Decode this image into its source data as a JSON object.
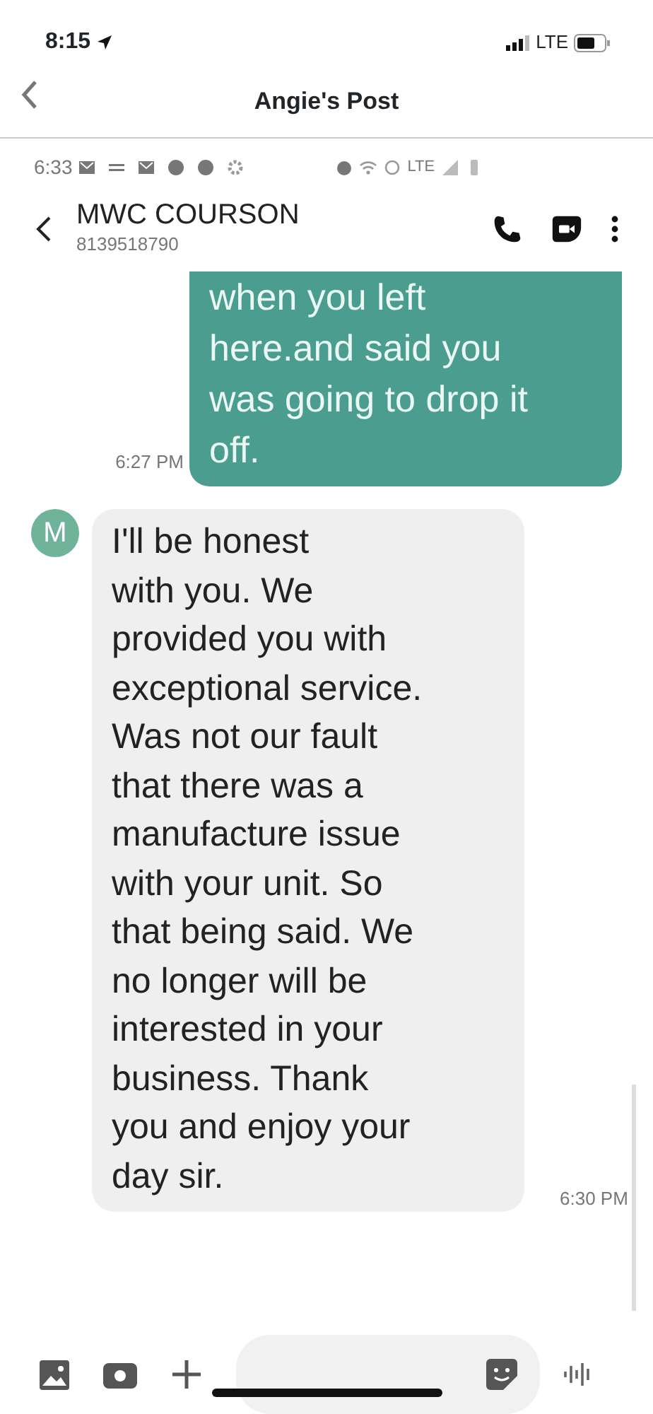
{
  "ios_status_bar": {
    "time": "8:15",
    "network": "LTE"
  },
  "nav_bar": {
    "title": "Angie's Post"
  },
  "android_status_bar": {
    "time": "6:33",
    "network": "LTE"
  },
  "conversation_header": {
    "contact_name": "MWC COURSON",
    "phone_number": "8139518790"
  },
  "messages": [
    {
      "kind": "sent",
      "lines": [
        "when you left",
        "here.and said you",
        "was going to drop it",
        "off."
      ],
      "time": "6:27 PM"
    },
    {
      "kind": "received",
      "avatar_letter": "M",
      "lines": [
        "I'll be honest",
        "with you. We",
        "provided you with",
        "exceptional service.",
        "Was not our fault",
        "that there was a",
        "manufacture issue",
        "with your unit. So",
        "that being said. We",
        "no longer will be",
        "interested in your",
        "business. Thank",
        "you and enjoy your",
        "day sir."
      ],
      "time": "6:30 PM"
    }
  ]
}
